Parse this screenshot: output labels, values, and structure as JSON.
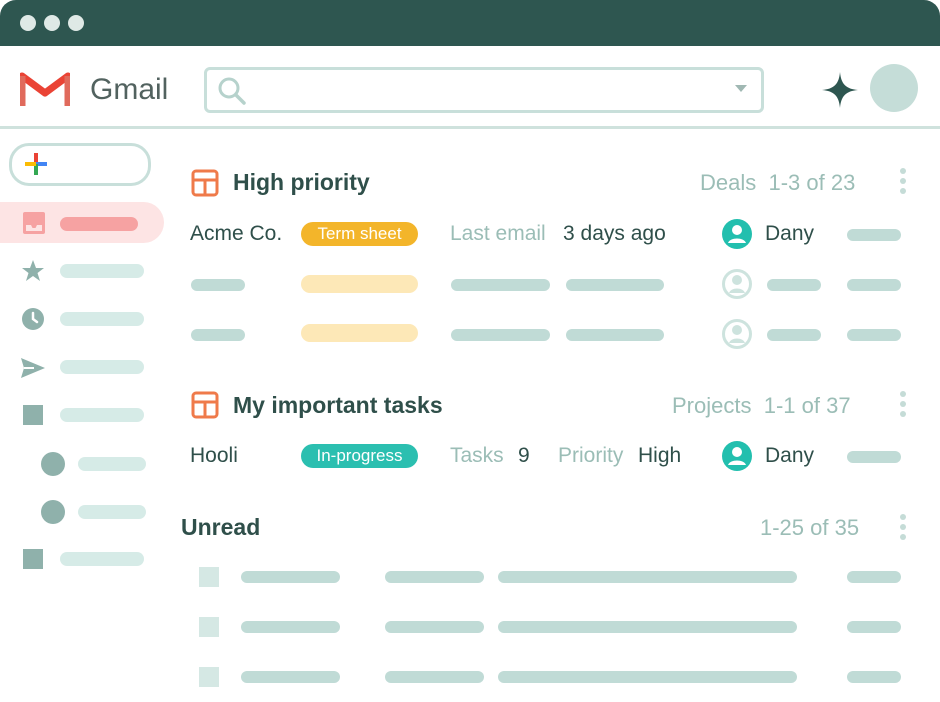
{
  "app": {
    "name": "Gmail"
  },
  "search": {
    "placeholder": ""
  },
  "sections": [
    {
      "title": "High priority",
      "meta_label": "Deals",
      "meta_range": "1-3 of 23",
      "row": {
        "name": "Acme Co.",
        "chip": "Term sheet",
        "field1_label": "Last email",
        "field1_value": "3 days ago",
        "person": "Dany"
      }
    },
    {
      "title": "My important tasks",
      "meta_label": "Projects",
      "meta_range": "1-1 of 37",
      "row": {
        "name": "Hooli",
        "chip": "In-progress",
        "field1_label": "Tasks",
        "field1_value": "9",
        "field2_label": "Priority",
        "field2_value": "High",
        "person": "Dany"
      }
    },
    {
      "title": "Unread",
      "meta_range": "1-25 of 35"
    }
  ],
  "colors": {
    "titlebar": "#2e5650",
    "accent_orange": "#ef7a4a",
    "chip_yellow": "#f3b52a",
    "chip_teal": "#2bbfb0",
    "person_teal": "#22bfae"
  }
}
